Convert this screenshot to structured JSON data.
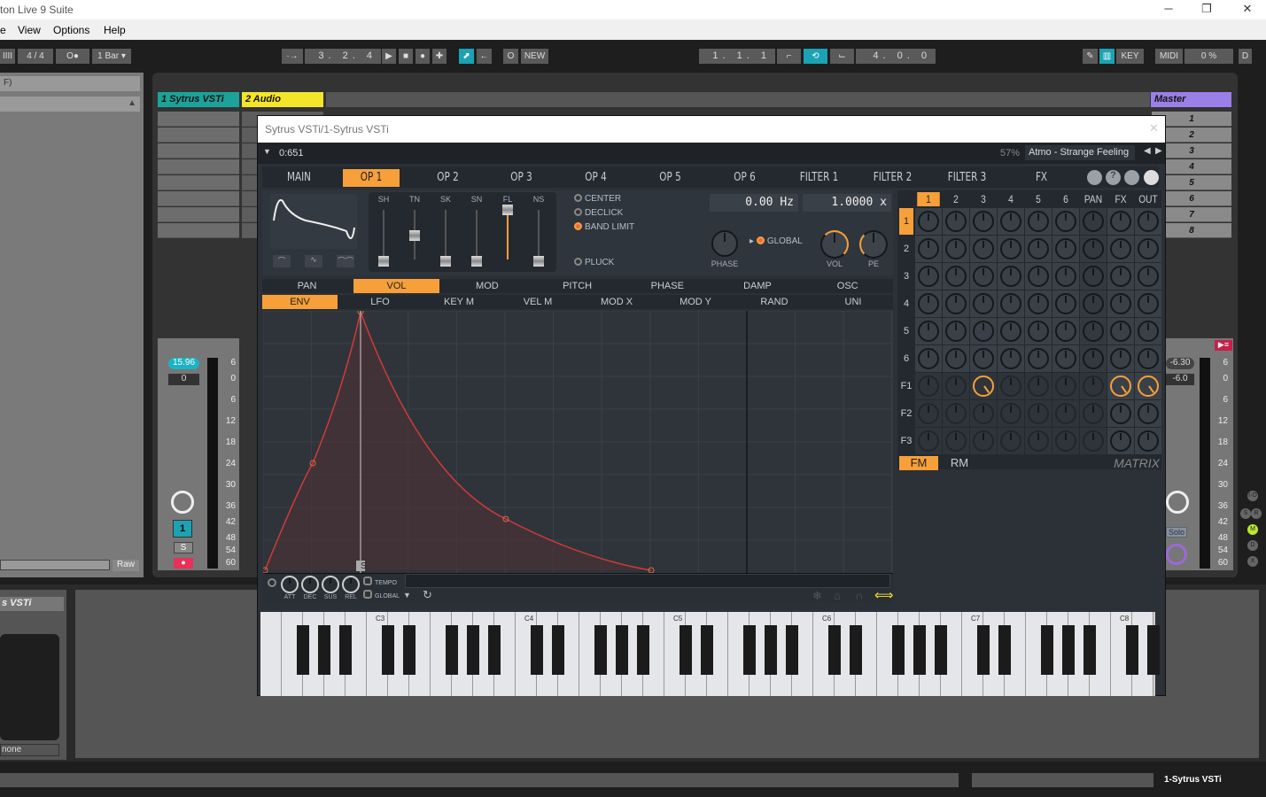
{
  "app": {
    "title": "ton Live 9 Suite",
    "window_controls": [
      "─",
      "❐",
      "✕"
    ]
  },
  "menu": [
    "e",
    "View",
    "Options",
    "Help"
  ],
  "toolbar": {
    "meter": "IIII",
    "time_sig": "4 / 4",
    "metro": "O●",
    "metro_arrow": "▾",
    "quantize": "1 Bar ▾",
    "follow": "·→",
    "position": "3. 2. 4",
    "play": "▶",
    "stop": "■",
    "rec": "●",
    "add": "✚",
    "automation": "⬈",
    "back": "←",
    "loop_o": "O",
    "new": "NEW",
    "loop_start": "1. 1. 1",
    "punch_in": "⌐",
    "loop": "⟲",
    "punch_out": "⌙",
    "loop_len": "4. 0. 0",
    "draw": "✎",
    "keyboard": "▥",
    "key": "KEY",
    "midi": "MIDI",
    "cpu": "0 %",
    "d": "D"
  },
  "browser": {
    "search": "F)",
    "scroll_up": "▲",
    "raw": "Raw"
  },
  "tracks": [
    {
      "name": "1 Sytrus VSTi",
      "color": "#1ba39a"
    },
    {
      "name": "2 Audio",
      "color": "#f5e52a"
    },
    {
      "name": "Master",
      "color": "#9b7fe8"
    }
  ],
  "master_scenes": [
    "1",
    "2",
    "3",
    "4",
    "5",
    "6",
    "7",
    "8"
  ],
  "mixer1": {
    "volume": "15.96",
    "pan": "0",
    "arm": "1",
    "solo": "S",
    "rec": "●",
    "scale": [
      "6",
      "0",
      "6",
      "12",
      "18",
      "24",
      "30",
      "36",
      "42",
      "48",
      "54",
      "60"
    ]
  },
  "master": {
    "volume": "-6.30",
    "pan": "-6.0",
    "solo": "Solo",
    "scale": [
      "6",
      "0",
      "6",
      "12",
      "18",
      "24",
      "30",
      "36",
      "42",
      "48",
      "54",
      "60"
    ],
    "side": [
      "I·O",
      "S",
      "R",
      "M",
      "D",
      "X"
    ]
  },
  "plugin": {
    "title": "Sytrus VSTi/1-Sytrus VSTi",
    "position": "0:651",
    "zoom": "57%",
    "preset": "Atmo - Strange Feeling",
    "tabs": [
      "MAIN",
      "OP 1",
      "OP 2",
      "OP 3",
      "OP 4",
      "OP 5",
      "OP 6",
      "FILTER 1",
      "FILTER 2",
      "FILTER 3",
      "FX"
    ],
    "active_tab": "OP 1",
    "sliders": [
      {
        "label": "SH",
        "value": 0
      },
      {
        "label": "TN",
        "value": 0.5
      },
      {
        "label": "SK",
        "value": 0
      },
      {
        "label": "SN",
        "value": 0
      },
      {
        "label": "FL",
        "value": 1
      },
      {
        "label": "NS",
        "value": 0
      }
    ],
    "options": [
      {
        "label": "CENTER",
        "on": false
      },
      {
        "label": "DECLICK",
        "on": false
      },
      {
        "label": "BAND LIMIT",
        "on": true
      },
      {
        "label": "PLUCK",
        "on": false
      }
    ],
    "freq": "0.00 Hz",
    "ratio": "1.0000 x",
    "knobs": {
      "phase": "PHASE",
      "global": "GLOBAL",
      "vol": "VOL",
      "pe": "PE"
    },
    "mod_tabs": [
      "PAN",
      "VOL",
      "MOD",
      "PITCH",
      "PHASE",
      "DAMP",
      "OSC"
    ],
    "env_tabs": [
      "ENV",
      "LFO",
      "KEY M",
      "VEL M",
      "MOD X",
      "MOD Y",
      "RAND",
      "UNI"
    ],
    "env_knobs": [
      "ATT",
      "DEC",
      "SUS",
      "REL"
    ],
    "env_opts": [
      "TEMPO",
      "GLOBAL"
    ],
    "sustain_marker": "S",
    "matrix": {
      "cols": [
        "1",
        "2",
        "3",
        "4",
        "5",
        "6",
        "PAN",
        "FX",
        "OUT"
      ],
      "rows": [
        "1",
        "2",
        "3",
        "4",
        "5",
        "6",
        "F1",
        "F2",
        "F3"
      ],
      "active": [
        {
          "row": "F1",
          "col": "3"
        },
        {
          "row": "F1",
          "col": "FX"
        },
        {
          "row": "F1",
          "col": "OUT"
        }
      ],
      "modes": [
        "FM",
        "RM"
      ],
      "title": "MATRIX"
    },
    "octaves": [
      "C3",
      "C4",
      "C5",
      "C6",
      "C7",
      "C8"
    ],
    "accent": "#f7a03a"
  },
  "device": {
    "name": "s VSTi",
    "preset": "none"
  },
  "status": {
    "track": "1-Sytrus VSTi"
  }
}
